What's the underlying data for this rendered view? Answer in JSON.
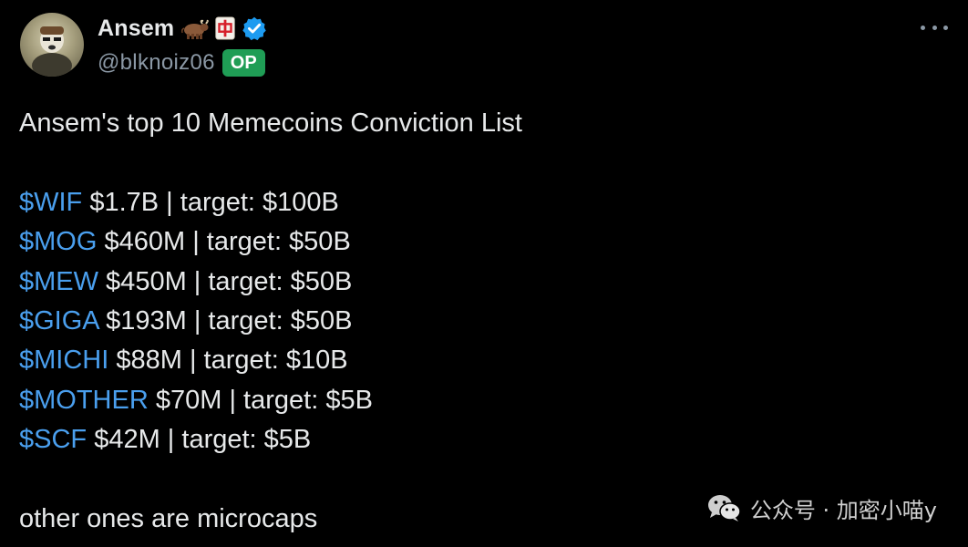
{
  "author": {
    "display_name": "Ansem",
    "emoji_1": "water-buffalo-emoji",
    "emoji_2": "mahjong-red-dragon-emoji",
    "handle": "@blknoiz06",
    "badge": "OP",
    "verified_icon": "verified-badge-icon",
    "verified_color": "#1d9bf0",
    "badge_color": "#1f9d55"
  },
  "menu_icon": "more-horizontal-icon",
  "tweet": {
    "title": "Ansem's top 10 Memecoins Conviction List",
    "coins": [
      {
        "ticker": "$WIF",
        "details": " $1.7B | target: $100B"
      },
      {
        "ticker": "$MOG",
        "details": " $460M | target: $50B"
      },
      {
        "ticker": "$MEW",
        "details": " $450M | target: $50B"
      },
      {
        "ticker": "$GIGA",
        "details": " $193M | target: $50B"
      },
      {
        "ticker": "$MICHI",
        "details": " $88M | target: $10B"
      },
      {
        "ticker": "$MOTHER",
        "details": " $70M | target: $5B"
      },
      {
        "ticker": "$SCF",
        "details": " $42M | target: $5B"
      }
    ],
    "footer": "other ones are microcaps",
    "cashtag_color": "#4a9fee"
  },
  "watermark": {
    "icon": "wechat-icon",
    "text": "公众号 · 加密小喵y"
  }
}
